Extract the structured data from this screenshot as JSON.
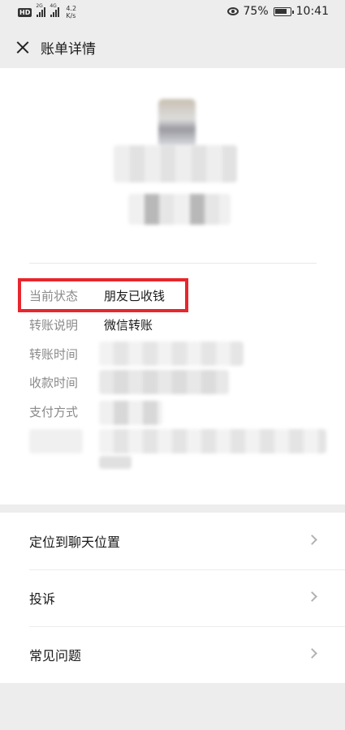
{
  "status_bar": {
    "hd_badge": "HD",
    "net_tag_1": "2G",
    "net_tag_2": "4G",
    "net_speed_value": "4.2",
    "net_speed_unit": "K/s",
    "battery": "75%",
    "time": "10:41"
  },
  "nav": {
    "title": "账单详情"
  },
  "details": [
    {
      "label": "当前状态",
      "value": "朋友已收钱"
    },
    {
      "label": "转账说明",
      "value": "微信转账"
    },
    {
      "label": "转账时间",
      "value": ""
    },
    {
      "label": "收款时间",
      "value": ""
    },
    {
      "label": "支付方式",
      "value": ""
    }
  ],
  "actions": [
    {
      "label": "定位到聊天位置"
    },
    {
      "label": "投诉"
    },
    {
      "label": "常见问题"
    }
  ],
  "colors": {
    "highlight_border": "#e8262c",
    "page_background": "#ededed"
  }
}
